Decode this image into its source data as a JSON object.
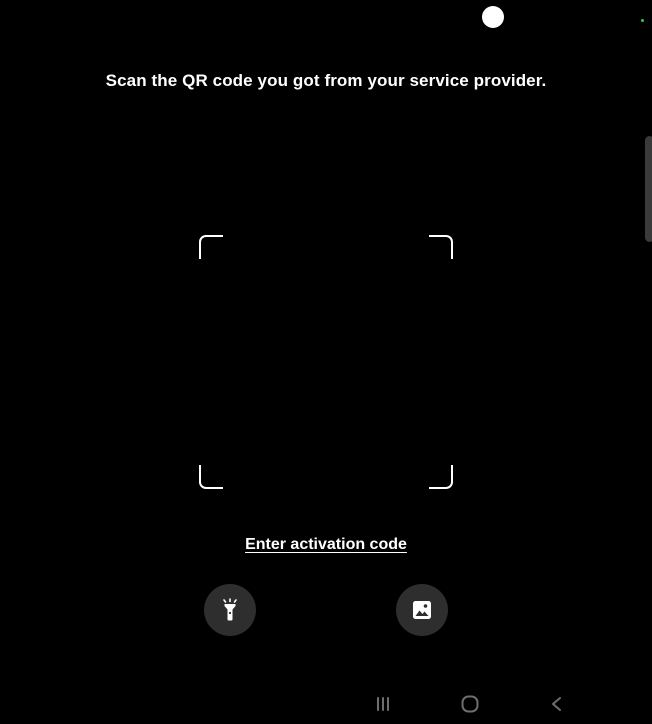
{
  "status_bar": {
    "camera_icon": "camera-dot",
    "indicator_color": "#2ecc40"
  },
  "scanner": {
    "instruction": "Scan the QR code you got from your service provider.",
    "frame_icon": "qr-scan-frame",
    "activation_link": "Enter activation code"
  },
  "actions": {
    "flashlight_icon": "flashlight-icon",
    "gallery_icon": "image-gallery-icon",
    "button_bg": "#2e2e2e"
  },
  "nav_bar": {
    "recents_icon": "recents-icon",
    "home_icon": "home-icon",
    "back_icon": "back-icon"
  }
}
